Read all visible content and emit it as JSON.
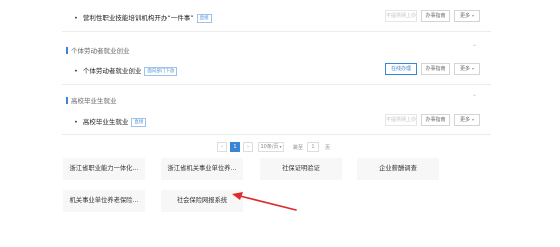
{
  "rows": [
    {
      "title": "营利性职业技能培训机构开办“一件事”",
      "tag": "直接",
      "btn_online": "不提供网上办",
      "btn_guide": "办事指南",
      "btn_more": "更多"
    },
    {
      "title": "个体劳动者就业创业",
      "tag": "面向部门下放",
      "btn_online": "在线办理",
      "btn_guide": "办事指南",
      "btn_more": "更多"
    },
    {
      "title": "高校毕业生就业",
      "tag": "直接",
      "btn_online": "不提供网上办",
      "btn_guide": "办事指南",
      "btn_more": "更多"
    }
  ],
  "sections": [
    {
      "title": "个体劳动者就业创业"
    },
    {
      "title": "高校毕业生就业"
    }
  ],
  "pager": {
    "prev": "‹",
    "current": "1",
    "next": "›",
    "page_size": "10条/页",
    "goto_label": "跳至",
    "goto_value": "1",
    "page_unit": "页"
  },
  "tiles": [
    "浙江省职业能力一体化...",
    "浙江省机关事业单位养...",
    "社保证明验证",
    "企业薪酬调查",
    "机关事业单位养老保险...",
    "社会保险网报系统"
  ],
  "colors": {
    "accent": "#3a86d6",
    "arrow": "#e02a2a"
  }
}
